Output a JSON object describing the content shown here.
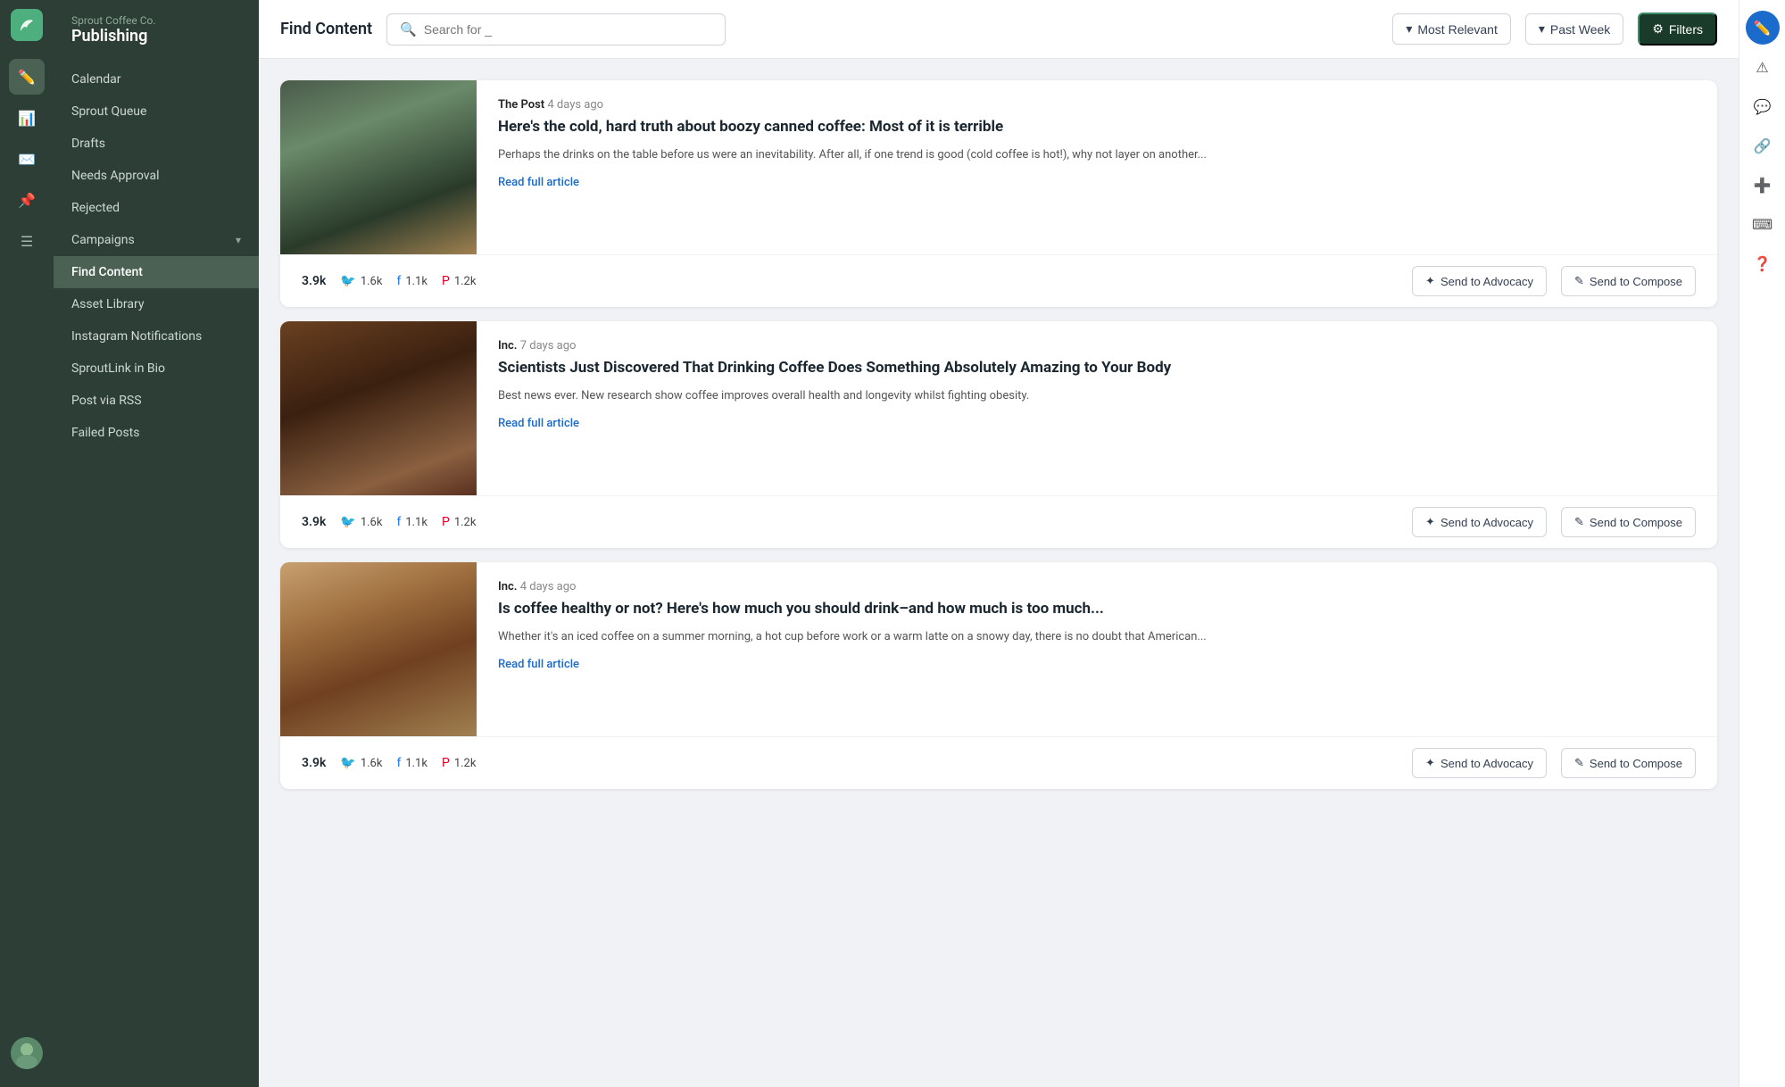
{
  "brand": {
    "company": "Sprout Coffee Co.",
    "product": "Publishing"
  },
  "sidebar": {
    "items": [
      {
        "label": "Calendar",
        "active": false
      },
      {
        "label": "Sprout Queue",
        "active": false
      },
      {
        "label": "Drafts",
        "active": false
      },
      {
        "label": "Needs Approval",
        "active": false
      },
      {
        "label": "Rejected",
        "active": false
      },
      {
        "label": "Campaigns",
        "active": false,
        "hasChevron": true
      },
      {
        "label": "Find Content",
        "active": true
      },
      {
        "label": "Asset Library",
        "active": false
      },
      {
        "label": "Instagram Notifications",
        "active": false
      },
      {
        "label": "SproutLink in Bio",
        "active": false
      },
      {
        "label": "Post via RSS",
        "active": false
      },
      {
        "label": "Failed Posts",
        "active": false
      }
    ]
  },
  "header": {
    "title": "Find Content",
    "search_placeholder": "Search for _",
    "filters": [
      {
        "label": "Most Relevant",
        "has_chevron": true
      },
      {
        "label": "Past Week",
        "has_chevron": true
      },
      {
        "label": "Filters",
        "has_icon": true
      }
    ]
  },
  "articles": [
    {
      "source": "The Post",
      "time": "4 days ago",
      "title": "Here's the cold, hard truth about boozy canned coffee: Most of it is terrible",
      "excerpt": "Perhaps the drinks on the table before us were an inevitability. After all, if one trend is good (cold coffee is hot!), why not layer on another...",
      "read_more": "Read full article",
      "stats": {
        "total": "3.9k",
        "twitter": "1.6k",
        "facebook": "1.1k",
        "pinterest": "1.2k"
      },
      "actions": [
        "Send to Advocacy",
        "Send to Compose"
      ],
      "img_class": "img-coffee1"
    },
    {
      "source": "Inc.",
      "time": "7 days ago",
      "title": "Scientists Just Discovered That Drinking Coffee Does Something Absolutely Amazing to Your Body",
      "excerpt": "Best news ever. New research show coffee improves overall health and longevity whilst fighting obesity.",
      "read_more": "Read full article",
      "stats": {
        "total": "3.9k",
        "twitter": "1.6k",
        "facebook": "1.1k",
        "pinterest": "1.2k"
      },
      "actions": [
        "Send to Advocacy",
        "Send to Compose"
      ],
      "img_class": "img-coffee2"
    },
    {
      "source": "Inc.",
      "time": "4 days ago",
      "title": "Is coffee healthy or not? Here's how much you should drink–and how much is too much...",
      "excerpt": "Whether it's an iced coffee on a summer morning, a hot cup before work or a warm latte on a snowy day, there is no doubt that American...",
      "read_more": "Read full article",
      "stats": {
        "total": "3.9k",
        "twitter": "1.6k",
        "facebook": "1.1k",
        "pinterest": "1.2k"
      },
      "actions": [
        "Send to Advocacy",
        "Send to Compose"
      ],
      "img_class": "img-coffee3"
    }
  ],
  "right_rail": {
    "icons": [
      "compose",
      "alert",
      "message",
      "link",
      "add",
      "keyboard",
      "help"
    ]
  }
}
